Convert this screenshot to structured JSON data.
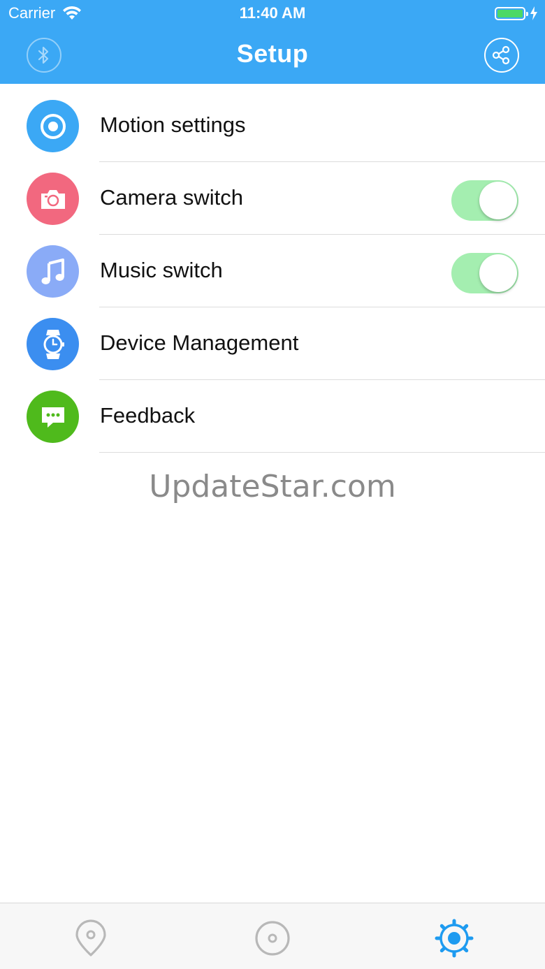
{
  "status_bar": {
    "carrier": "Carrier",
    "time": "11:40 AM",
    "wifi_icon": "wifi-icon",
    "battery_icon": "battery-icon",
    "charging_icon": "bolt-icon"
  },
  "header": {
    "title": "Setup",
    "left_icon": "bluetooth-icon",
    "right_icon": "share-icon",
    "background_color": "#3ba8f5"
  },
  "settings": [
    {
      "label": "Motion settings",
      "icon": "target-icon",
      "icon_color": "#3ba8f5"
    },
    {
      "label": "Camera switch",
      "icon": "camera-icon",
      "icon_color": "#f2687f",
      "toggle_on": true
    },
    {
      "label": "Music switch",
      "icon": "music-note-icon",
      "icon_color": "#8aabf7",
      "toggle_on": true
    },
    {
      "label": "Device Management",
      "icon": "watch-icon",
      "icon_color": "#3b8ef0"
    },
    {
      "label": "Feedback",
      "icon": "chat-bubble-icon",
      "icon_color": "#4fba1c"
    }
  ],
  "watermark": "UpdateStar.com",
  "tab_bar": {
    "tabs": [
      {
        "icon": "location-pin-icon",
        "active": false
      },
      {
        "icon": "record-icon",
        "active": false
      },
      {
        "icon": "settings-gear-icon",
        "active": true
      }
    ],
    "active_color": "#1e9bf0",
    "inactive_color": "#b8b8b8"
  },
  "toggle_color": "#a4eeb0"
}
